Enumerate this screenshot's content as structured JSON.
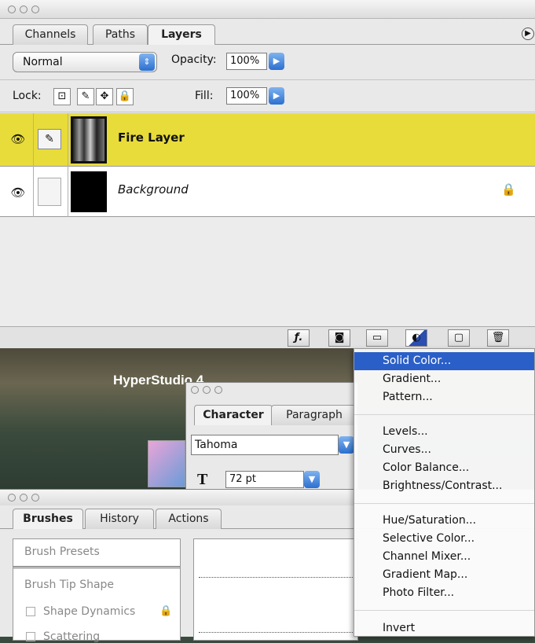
{
  "layers_panel": {
    "tabs": [
      "Channels",
      "Paths",
      "Layers"
    ],
    "blend_mode": "Normal",
    "opacity_label": "Opacity:",
    "opacity_value": "100%",
    "lock_label": "Lock:",
    "fill_label": "Fill:",
    "fill_value": "100%",
    "layers": [
      {
        "name": "Fire Layer",
        "selected": true
      },
      {
        "name": "Background",
        "selected": false,
        "locked": true
      }
    ]
  },
  "background_window": {
    "title": "HyperStudio 4"
  },
  "character_panel": {
    "tabs": [
      "Character",
      "Paragraph"
    ],
    "font": "Tahoma",
    "size": "72 pt"
  },
  "brushes_panel": {
    "tabs": [
      "Brushes",
      "History",
      "Actions"
    ],
    "items": [
      "Brush Presets",
      "Brush Tip Shape",
      "Shape Dynamics",
      "Scattering"
    ]
  },
  "adjustment_menu": {
    "group1": [
      "Solid Color...",
      "Gradient...",
      "Pattern..."
    ],
    "group2": [
      "Levels...",
      "Curves...",
      "Color Balance...",
      "Brightness/Contrast..."
    ],
    "group3": [
      "Hue/Saturation...",
      "Selective Color...",
      "Channel Mixer...",
      "Gradient Map...",
      "Photo Filter..."
    ],
    "group4": [
      "Invert"
    ],
    "highlighted": "Solid Color..."
  },
  "colors": {
    "selected_layer": "#e8dc3a",
    "menu_highlight": "#2b5fc8",
    "accent_blue": "#2b6fd0"
  }
}
